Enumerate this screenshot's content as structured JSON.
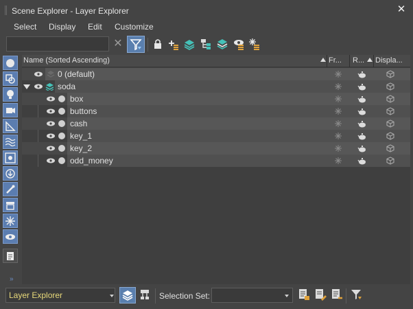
{
  "window": {
    "title": "Scene Explorer - Layer Explorer",
    "close_glyph": "✕"
  },
  "menu": [
    "Select",
    "Display",
    "Edit",
    "Customize"
  ],
  "toolbar": {
    "search_value": "",
    "clear_glyph": "✕",
    "icons": [
      "filter-icon",
      "lock-icon",
      "new-layer-icon",
      "add-to-layer-icon",
      "select-in-layer-icon",
      "layers-icon",
      "hide-icon",
      "freeze-icon"
    ]
  },
  "columns": {
    "name": "Name (Sorted Ascending)",
    "frozen": "Fr...",
    "render": "R...",
    "display": "Displa..."
  },
  "rows": [
    {
      "label": "0 (default)",
      "type": "layer"
    },
    {
      "label": "soda",
      "type": "layer-active"
    },
    {
      "label": "box",
      "type": "object"
    },
    {
      "label": "buttons",
      "type": "object"
    },
    {
      "label": "cash",
      "type": "object"
    },
    {
      "label": "key_1",
      "type": "object"
    },
    {
      "label": "key_2",
      "type": "object"
    },
    {
      "label": "odd_money",
      "type": "object"
    }
  ],
  "left_filters": [
    "geometry-icon",
    "shape-icon",
    "light-icon",
    "camera-icon",
    "helper-icon",
    "spacewarp-icon",
    "group-icon",
    "xref-icon",
    "bone-icon",
    "container-icon",
    "frozen-icon",
    "hidden-icon",
    "document-icon"
  ],
  "status": {
    "explorer_value": "Layer Explorer",
    "selection_set_label": "Selection Set:",
    "selection_set_value": ""
  },
  "colors": {
    "accent": "#5a7fae",
    "highlight_text": "#e8d97a"
  }
}
